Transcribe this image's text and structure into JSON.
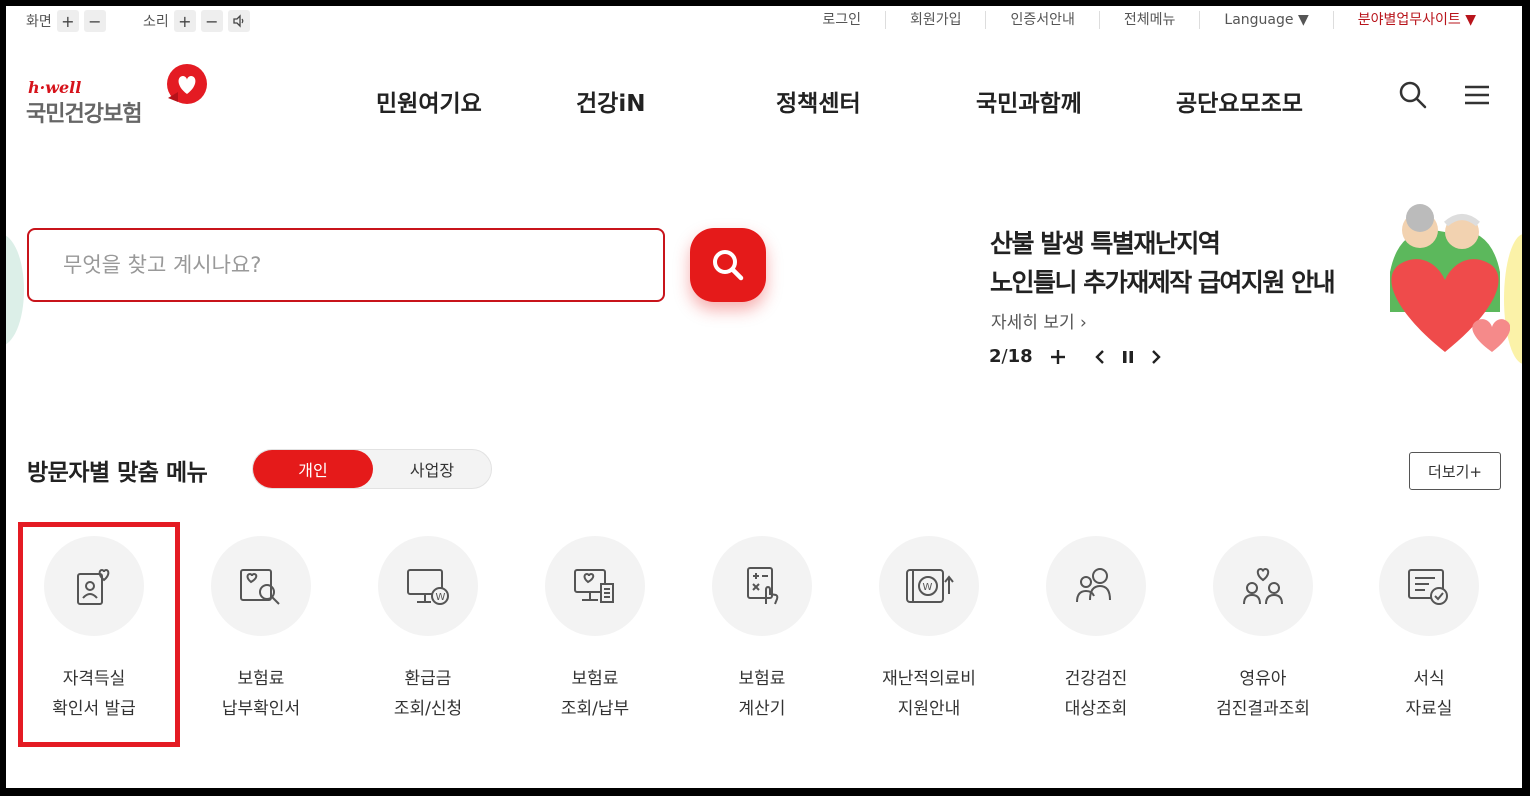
{
  "utility": {
    "screen_label": "화면",
    "sound_label": "소리",
    "plus": "+",
    "minus": "−",
    "links": [
      "로그인",
      "회원가입",
      "인증서안내",
      "전체메뉴",
      "Language ▼"
    ],
    "business_site": "분야별업무사이트 ▼"
  },
  "logo": {
    "sub": "h·well",
    "main": "국민건강보험"
  },
  "gnb": [
    "민원여기요",
    "건강iN",
    "정책센터",
    "국민과함께",
    "공단요모조모"
  ],
  "search": {
    "placeholder": "무엇을 찾고 계시나요?"
  },
  "banner": {
    "title_line1": "산불 발생 특별재난지역",
    "title_line2": "노인틀니 추가재제작 급여지원 안내",
    "more": "자세히 보기 ›",
    "current": "2",
    "sep": " / ",
    "total": "18"
  },
  "custom_menu": {
    "title": "방문자별 맞춤 메뉴",
    "tab_personal": "개인",
    "tab_business": "사업장",
    "more": "더보기+",
    "items": [
      {
        "line1": "자격득실",
        "line2": "확인서 발급",
        "icon": "id-card-heart-icon"
      },
      {
        "line1": "보험료",
        "line2": "납부확인서",
        "icon": "search-document-icon"
      },
      {
        "line1": "환급금",
        "line2": "조회/신청",
        "icon": "monitor-won-icon"
      },
      {
        "line1": "보험료",
        "line2": "조회/납부",
        "icon": "monitor-receipt-icon"
      },
      {
        "line1": "보험료",
        "line2": "계산기",
        "icon": "calculator-icon"
      },
      {
        "line1": "재난적의료비",
        "line2": "지원안내",
        "icon": "won-wallet-icon"
      },
      {
        "line1": "건강검진",
        "line2": "대상조회",
        "icon": "people-search-icon"
      },
      {
        "line1": "영유아",
        "line2": "검진결과조회",
        "icon": "family-heart-icon"
      },
      {
        "line1": "서식",
        "line2": "자료실",
        "icon": "form-check-icon"
      }
    ]
  }
}
